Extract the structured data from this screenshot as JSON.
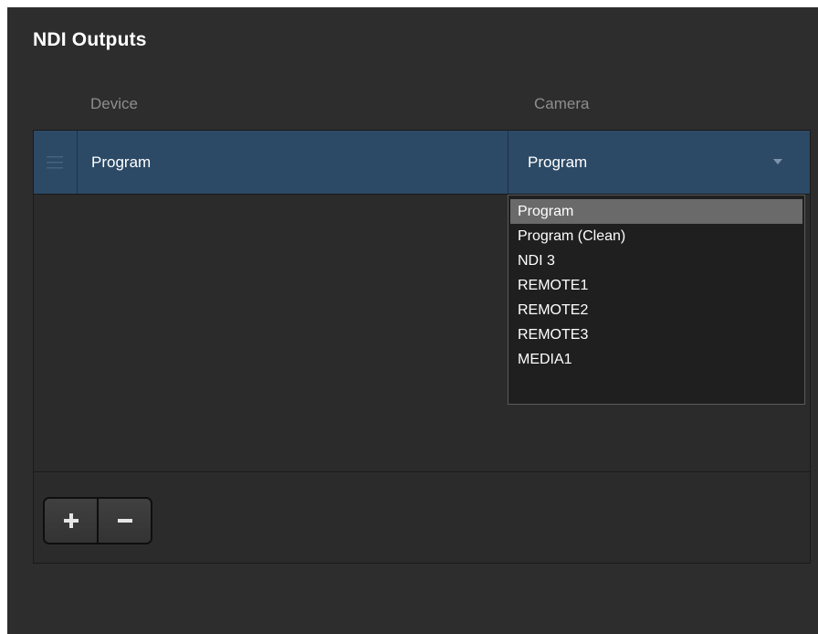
{
  "panel": {
    "title": "NDI Outputs"
  },
  "columns": {
    "device": "Device",
    "camera": "Camera"
  },
  "rows": [
    {
      "device": "Program",
      "camera": "Program"
    }
  ],
  "dropdown": {
    "selected": "Program",
    "options": [
      "Program",
      "Program (Clean)",
      "NDI 3",
      "REMOTE1",
      "REMOTE2",
      "REMOTE3",
      "MEDIA1"
    ]
  },
  "icons": {
    "drag": "drag-handle-icon",
    "chevron": "chevron-down-icon",
    "add": "plus-icon",
    "remove": "minus-icon"
  },
  "colors": {
    "panel_bg": "#2d2d2d",
    "row_selected": "#2c4a66",
    "dropdown_highlight": "#6a6a6a"
  }
}
